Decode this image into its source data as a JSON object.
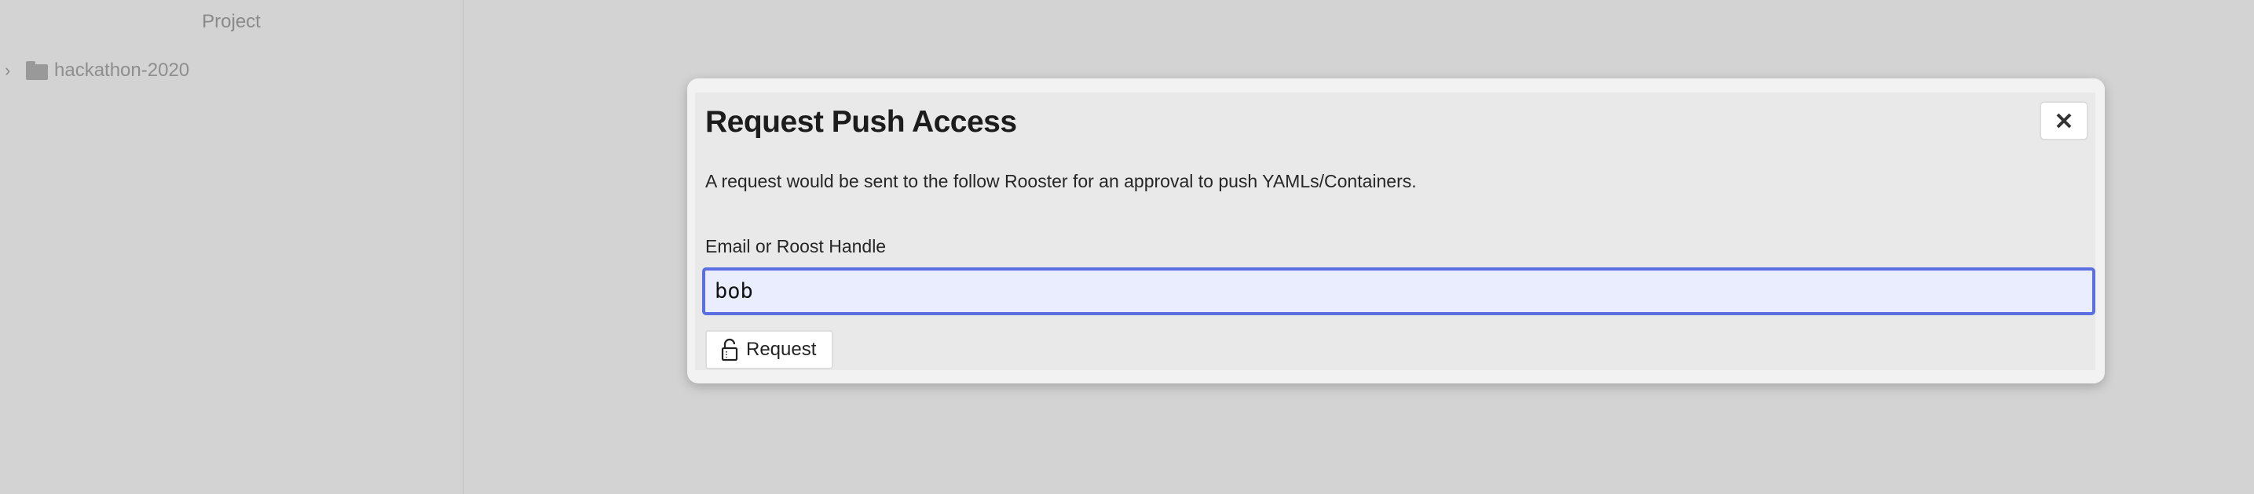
{
  "sidebar": {
    "title": "Project",
    "tree": [
      {
        "label": "hackathon-2020",
        "icon": "folder-icon",
        "expanded": false
      }
    ]
  },
  "modal": {
    "title": "Request Push Access",
    "description": "A request would be sent to the follow Rooster for an approval to push YAMLs/Containers.",
    "field_label": "Email or Roost Handle",
    "field_value": "bob",
    "request_label": "Request",
    "request_icon": "unlock-icon",
    "close_icon": "close-icon"
  },
  "colors": {
    "focus_border": "#5b6fe0",
    "input_bg": "#eaedfd"
  }
}
